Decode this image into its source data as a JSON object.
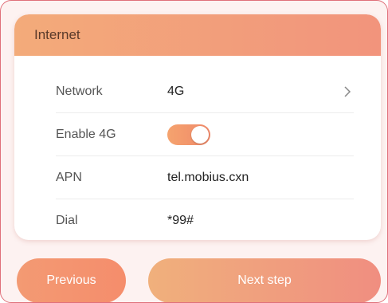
{
  "card": {
    "title": "Internet"
  },
  "rows": [
    {
      "label": "Network",
      "value": "4G"
    },
    {
      "label": "Enable 4G",
      "toggle_on": true
    },
    {
      "label": "APN",
      "value": "tel.mobius.cxn"
    },
    {
      "label": "Dial",
      "value": "*99#"
    }
  ],
  "icons": {
    "network_chevron": "chevron-right-icon"
  },
  "buttons": {
    "previous": "Previous",
    "next": "Next step"
  },
  "colors": {
    "accent_start": "#f3ab7a",
    "accent_end": "#f2947c",
    "frame_border": "#e0707a"
  }
}
